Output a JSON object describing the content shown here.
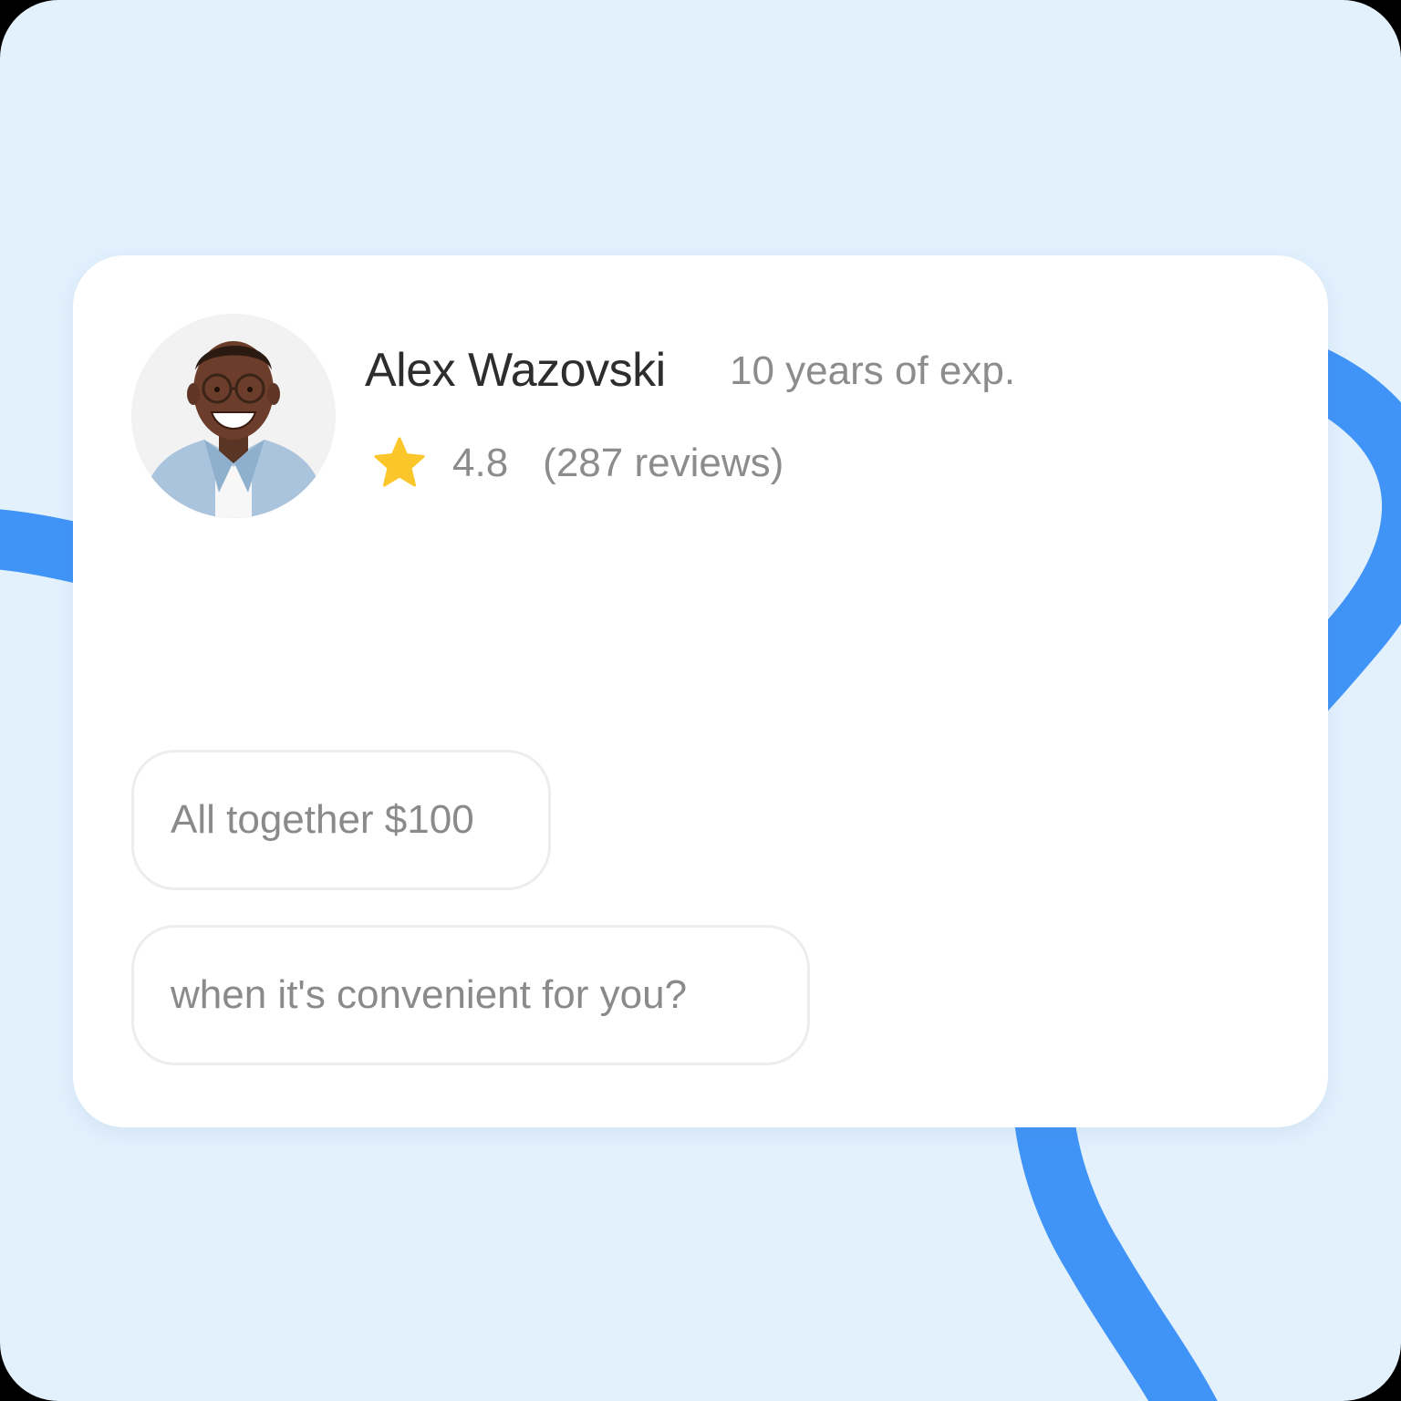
{
  "profile": {
    "name": "Alex Wazovski",
    "experience": "10 years of exp.",
    "rating": "4.8",
    "reviews": "(287 reviews)"
  },
  "messages": [
    {
      "text": "All together $100"
    },
    {
      "text": "when it's convenient for you?"
    }
  ],
  "colors": {
    "background": "#e3f1fd",
    "accent_curve": "#4094f7",
    "star": "#fbc62a",
    "card": "#ffffff"
  },
  "icons": {
    "rating": "star-icon"
  }
}
